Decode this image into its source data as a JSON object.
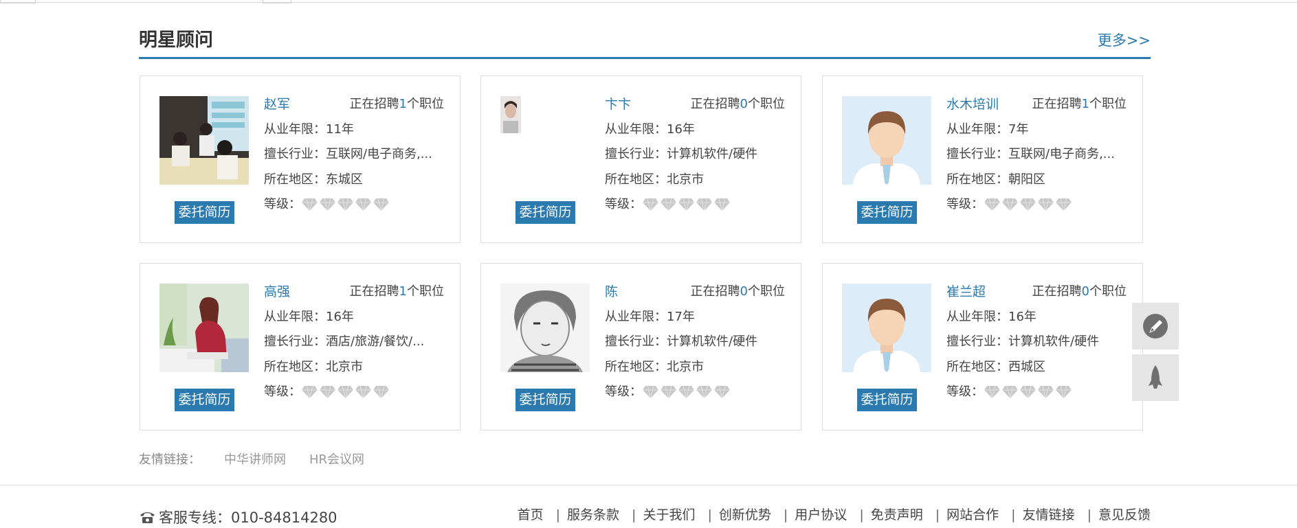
{
  "section": {
    "title": "明星顾问",
    "more": "更多>>"
  },
  "consultants": [
    {
      "name": "赵军",
      "recruit_prefix": "正在招聘",
      "recruit_count": "1",
      "recruit_suffix": "个职位",
      "years_label": "从业年限：",
      "years": "11年",
      "industry_label": "擅长行业：",
      "industry": "互联网/电子商务,...",
      "area_label": "所在地区：",
      "area": "东城区",
      "level_label": "等级：",
      "level": 0,
      "button": "委托简历",
      "photo_icon": "meeting-photo"
    },
    {
      "name": "卞卞",
      "recruit_prefix": "正在招聘",
      "recruit_count": "0",
      "recruit_suffix": "个职位",
      "years_label": "从业年限：",
      "years": "16年",
      "industry_label": "擅长行业：",
      "industry": "计算机软件/硬件",
      "area_label": "所在地区：",
      "area": "北京市",
      "level_label": "等级：",
      "level": 0,
      "button": "委托简历",
      "photo_icon": "portrait-photo"
    },
    {
      "name": "水木培训",
      "recruit_prefix": "正在招聘",
      "recruit_count": "1",
      "recruit_suffix": "个职位",
      "years_label": "从业年限：",
      "years": "7年",
      "industry_label": "擅长行业：",
      "industry": "互联网/电子商务,...",
      "area_label": "所在地区：",
      "area": "朝阳区",
      "level_label": "等级：",
      "level": 0,
      "button": "委托简历",
      "photo_icon": "default-avatar"
    },
    {
      "name": "高强",
      "recruit_prefix": "正在招聘",
      "recruit_count": "1",
      "recruit_suffix": "个职位",
      "years_label": "从业年限：",
      "years": "16年",
      "industry_label": "擅长行业：",
      "industry": "酒店/旅游/餐饮/...",
      "area_label": "所在地区：",
      "area": "北京市",
      "level_label": "等级：",
      "level": 0,
      "button": "委托简历",
      "photo_icon": "woman-photo"
    },
    {
      "name": "陈",
      "recruit_prefix": "正在招聘",
      "recruit_count": "0",
      "recruit_suffix": "个职位",
      "years_label": "从业年限：",
      "years": "17年",
      "industry_label": "擅长行业：",
      "industry": "计算机软件/硬件",
      "area_label": "所在地区：",
      "area": "北京市",
      "level_label": "等级：",
      "level": 0,
      "button": "委托简历",
      "photo_icon": "sketch-photo"
    },
    {
      "name": "崔兰超",
      "recruit_prefix": "正在招聘",
      "recruit_count": "0",
      "recruit_suffix": "个职位",
      "years_label": "从业年限：",
      "years": "16年",
      "industry_label": "擅长行业：",
      "industry": "计算机软件/硬件",
      "area_label": "所在地区：",
      "area": "西城区",
      "level_label": "等级：",
      "level": 0,
      "button": "委托简历",
      "photo_icon": "default-avatar"
    }
  ],
  "friend_links": {
    "label": "友情链接：",
    "links": [
      "中华讲师网",
      "HR会议网"
    ]
  },
  "footer": {
    "hotline": "客服专线：010-84814280",
    "nav": [
      "首页",
      "服务条款",
      "关于我们",
      "创新优势",
      "用户协议",
      "免责声明",
      "网站合作",
      "友情链接",
      "意见反馈"
    ]
  },
  "colors": {
    "accent": "#2a7ab0",
    "diamond_inactive": "#c8c8c8"
  }
}
